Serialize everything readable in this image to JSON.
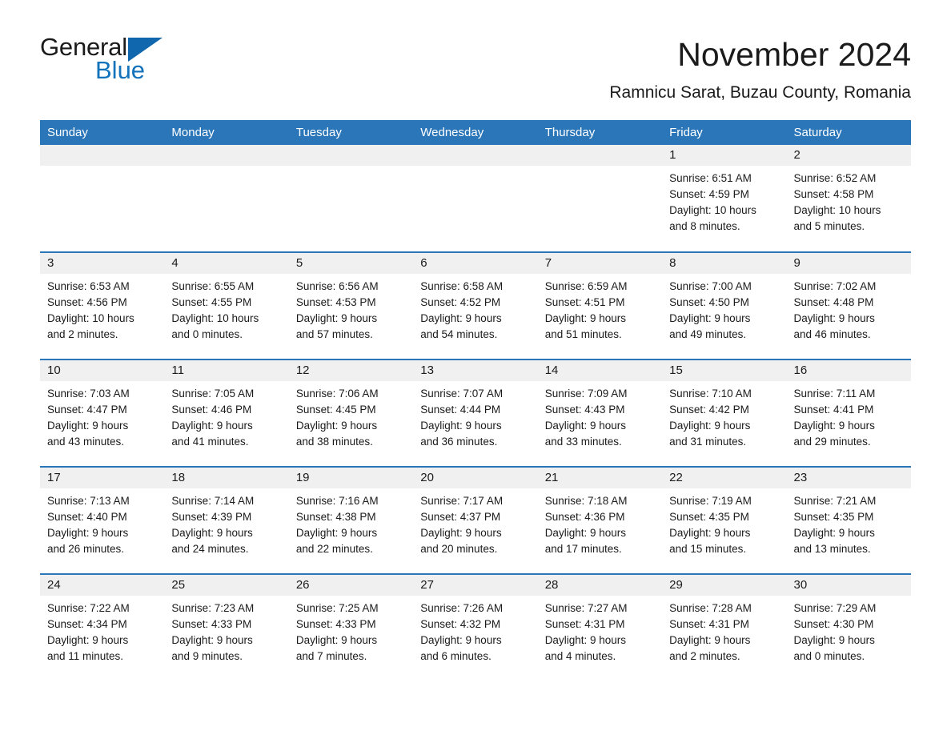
{
  "brand": {
    "name_part1": "General",
    "name_part2": "Blue",
    "logo_icon": "triangle-logo-icon"
  },
  "header": {
    "title": "November 2024",
    "subtitle": "Ramnicu Sarat, Buzau County, Romania"
  },
  "colors": {
    "header_blue": "#2b76b9",
    "brand_blue": "#1272bb",
    "daystrip_gray": "#f0f0f0",
    "text": "#1b1b1b"
  },
  "weekday_headers": [
    "Sunday",
    "Monday",
    "Tuesday",
    "Wednesday",
    "Thursday",
    "Friday",
    "Saturday"
  ],
  "weeks": [
    [
      {
        "day": "",
        "empty": true
      },
      {
        "day": "",
        "empty": true
      },
      {
        "day": "",
        "empty": true
      },
      {
        "day": "",
        "empty": true
      },
      {
        "day": "",
        "empty": true
      },
      {
        "day": "1",
        "sunrise": "Sunrise: 6:51 AM",
        "sunset": "Sunset: 4:59 PM",
        "daylight_line1": "Daylight: 10 hours",
        "daylight_line2": "and 8 minutes."
      },
      {
        "day": "2",
        "sunrise": "Sunrise: 6:52 AM",
        "sunset": "Sunset: 4:58 PM",
        "daylight_line1": "Daylight: 10 hours",
        "daylight_line2": "and 5 minutes."
      }
    ],
    [
      {
        "day": "3",
        "sunrise": "Sunrise: 6:53 AM",
        "sunset": "Sunset: 4:56 PM",
        "daylight_line1": "Daylight: 10 hours",
        "daylight_line2": "and 2 minutes."
      },
      {
        "day": "4",
        "sunrise": "Sunrise: 6:55 AM",
        "sunset": "Sunset: 4:55 PM",
        "daylight_line1": "Daylight: 10 hours",
        "daylight_line2": "and 0 minutes."
      },
      {
        "day": "5",
        "sunrise": "Sunrise: 6:56 AM",
        "sunset": "Sunset: 4:53 PM",
        "daylight_line1": "Daylight: 9 hours",
        "daylight_line2": "and 57 minutes."
      },
      {
        "day": "6",
        "sunrise": "Sunrise: 6:58 AM",
        "sunset": "Sunset: 4:52 PM",
        "daylight_line1": "Daylight: 9 hours",
        "daylight_line2": "and 54 minutes."
      },
      {
        "day": "7",
        "sunrise": "Sunrise: 6:59 AM",
        "sunset": "Sunset: 4:51 PM",
        "daylight_line1": "Daylight: 9 hours",
        "daylight_line2": "and 51 minutes."
      },
      {
        "day": "8",
        "sunrise": "Sunrise: 7:00 AM",
        "sunset": "Sunset: 4:50 PM",
        "daylight_line1": "Daylight: 9 hours",
        "daylight_line2": "and 49 minutes."
      },
      {
        "day": "9",
        "sunrise": "Sunrise: 7:02 AM",
        "sunset": "Sunset: 4:48 PM",
        "daylight_line1": "Daylight: 9 hours",
        "daylight_line2": "and 46 minutes."
      }
    ],
    [
      {
        "day": "10",
        "sunrise": "Sunrise: 7:03 AM",
        "sunset": "Sunset: 4:47 PM",
        "daylight_line1": "Daylight: 9 hours",
        "daylight_line2": "and 43 minutes."
      },
      {
        "day": "11",
        "sunrise": "Sunrise: 7:05 AM",
        "sunset": "Sunset: 4:46 PM",
        "daylight_line1": "Daylight: 9 hours",
        "daylight_line2": "and 41 minutes."
      },
      {
        "day": "12",
        "sunrise": "Sunrise: 7:06 AM",
        "sunset": "Sunset: 4:45 PM",
        "daylight_line1": "Daylight: 9 hours",
        "daylight_line2": "and 38 minutes."
      },
      {
        "day": "13",
        "sunrise": "Sunrise: 7:07 AM",
        "sunset": "Sunset: 4:44 PM",
        "daylight_line1": "Daylight: 9 hours",
        "daylight_line2": "and 36 minutes."
      },
      {
        "day": "14",
        "sunrise": "Sunrise: 7:09 AM",
        "sunset": "Sunset: 4:43 PM",
        "daylight_line1": "Daylight: 9 hours",
        "daylight_line2": "and 33 minutes."
      },
      {
        "day": "15",
        "sunrise": "Sunrise: 7:10 AM",
        "sunset": "Sunset: 4:42 PM",
        "daylight_line1": "Daylight: 9 hours",
        "daylight_line2": "and 31 minutes."
      },
      {
        "day": "16",
        "sunrise": "Sunrise: 7:11 AM",
        "sunset": "Sunset: 4:41 PM",
        "daylight_line1": "Daylight: 9 hours",
        "daylight_line2": "and 29 minutes."
      }
    ],
    [
      {
        "day": "17",
        "sunrise": "Sunrise: 7:13 AM",
        "sunset": "Sunset: 4:40 PM",
        "daylight_line1": "Daylight: 9 hours",
        "daylight_line2": "and 26 minutes."
      },
      {
        "day": "18",
        "sunrise": "Sunrise: 7:14 AM",
        "sunset": "Sunset: 4:39 PM",
        "daylight_line1": "Daylight: 9 hours",
        "daylight_line2": "and 24 minutes."
      },
      {
        "day": "19",
        "sunrise": "Sunrise: 7:16 AM",
        "sunset": "Sunset: 4:38 PM",
        "daylight_line1": "Daylight: 9 hours",
        "daylight_line2": "and 22 minutes."
      },
      {
        "day": "20",
        "sunrise": "Sunrise: 7:17 AM",
        "sunset": "Sunset: 4:37 PM",
        "daylight_line1": "Daylight: 9 hours",
        "daylight_line2": "and 20 minutes."
      },
      {
        "day": "21",
        "sunrise": "Sunrise: 7:18 AM",
        "sunset": "Sunset: 4:36 PM",
        "daylight_line1": "Daylight: 9 hours",
        "daylight_line2": "and 17 minutes."
      },
      {
        "day": "22",
        "sunrise": "Sunrise: 7:19 AM",
        "sunset": "Sunset: 4:35 PM",
        "daylight_line1": "Daylight: 9 hours",
        "daylight_line2": "and 15 minutes."
      },
      {
        "day": "23",
        "sunrise": "Sunrise: 7:21 AM",
        "sunset": "Sunset: 4:35 PM",
        "daylight_line1": "Daylight: 9 hours",
        "daylight_line2": "and 13 minutes."
      }
    ],
    [
      {
        "day": "24",
        "sunrise": "Sunrise: 7:22 AM",
        "sunset": "Sunset: 4:34 PM",
        "daylight_line1": "Daylight: 9 hours",
        "daylight_line2": "and 11 minutes."
      },
      {
        "day": "25",
        "sunrise": "Sunrise: 7:23 AM",
        "sunset": "Sunset: 4:33 PM",
        "daylight_line1": "Daylight: 9 hours",
        "daylight_line2": "and 9 minutes."
      },
      {
        "day": "26",
        "sunrise": "Sunrise: 7:25 AM",
        "sunset": "Sunset: 4:33 PM",
        "daylight_line1": "Daylight: 9 hours",
        "daylight_line2": "and 7 minutes."
      },
      {
        "day": "27",
        "sunrise": "Sunrise: 7:26 AM",
        "sunset": "Sunset: 4:32 PM",
        "daylight_line1": "Daylight: 9 hours",
        "daylight_line2": "and 6 minutes."
      },
      {
        "day": "28",
        "sunrise": "Sunrise: 7:27 AM",
        "sunset": "Sunset: 4:31 PM",
        "daylight_line1": "Daylight: 9 hours",
        "daylight_line2": "and 4 minutes."
      },
      {
        "day": "29",
        "sunrise": "Sunrise: 7:28 AM",
        "sunset": "Sunset: 4:31 PM",
        "daylight_line1": "Daylight: 9 hours",
        "daylight_line2": "and 2 minutes."
      },
      {
        "day": "30",
        "sunrise": "Sunrise: 7:29 AM",
        "sunset": "Sunset: 4:30 PM",
        "daylight_line1": "Daylight: 9 hours",
        "daylight_line2": "and 0 minutes."
      }
    ]
  ]
}
